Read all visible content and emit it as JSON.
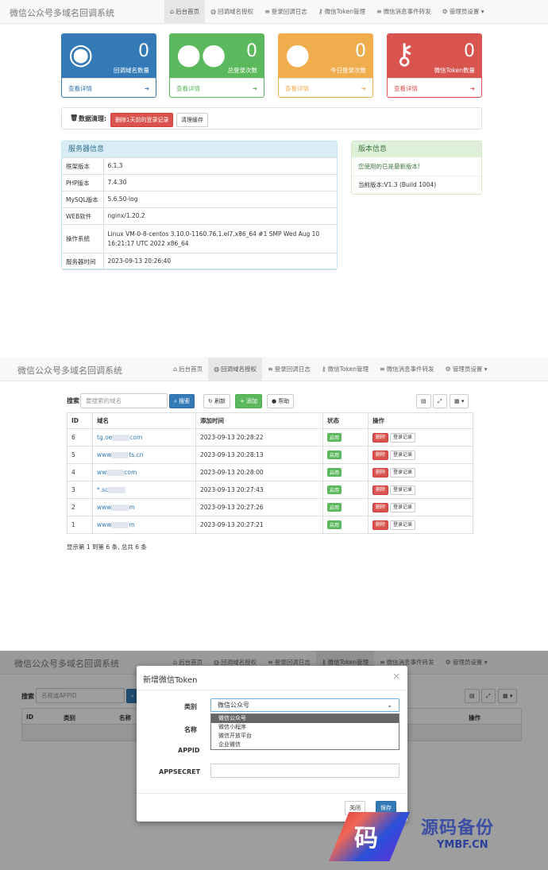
{
  "app_title": "微信公众号多域名回调系统",
  "nav": [
    {
      "label": "后台首页",
      "icon": "home-icon",
      "glyph": "⌂"
    },
    {
      "label": "回调域名授权",
      "icon": "globe-icon",
      "glyph": "◍"
    },
    {
      "label": "登录回调日志",
      "icon": "list-icon",
      "glyph": "≡"
    },
    {
      "label": "微信Token管理",
      "icon": "key-icon",
      "glyph": "⚷"
    },
    {
      "label": "微信消息事件转发",
      "icon": "list-icon",
      "glyph": "≡"
    },
    {
      "label": "管理员设置",
      "icon": "gear-icon",
      "glyph": "⚙",
      "suffix": " ▾"
    }
  ],
  "stats": [
    {
      "value": "0",
      "label": "回调域名数量",
      "link": "查看详情",
      "icon": "globe-icon",
      "glyph": "◉",
      "color": "#337ab7",
      "light": "#fff"
    },
    {
      "value": "0",
      "label": "总登录次数",
      "link": "查看详情",
      "icon": "users-icon",
      "glyph": "●●",
      "color": "#5cb85c",
      "light": "#fff"
    },
    {
      "value": "0",
      "label": "今日登录次数",
      "link": "查看详情",
      "icon": "user-icon",
      "glyph": "●",
      "color": "#f0ad4e",
      "light": "#fff"
    },
    {
      "value": "0",
      "label": "微信Token数量",
      "link": "查看详情",
      "icon": "key-icon",
      "glyph": "⚷",
      "color": "#d9534f",
      "light": "#fff"
    }
  ],
  "cleanup": {
    "label": "数据清理:",
    "delete_btn": "删除1天前的登录记录",
    "clear_btn": "清理缓存"
  },
  "server": {
    "title": "服务器信息",
    "rows": [
      [
        "框架版本",
        "6.1.3"
      ],
      [
        "PHP版本",
        "7.4.30"
      ],
      [
        "MySQL版本",
        "5.6.50-log"
      ],
      [
        "WEB软件",
        "nginx/1.20.2"
      ],
      [
        "操作系统",
        "Linux VM-0-8-centos 3.10.0-1160.76.1.el7.x86_64 #1 SMP Wed Aug 10 16:21:17 UTC 2022 x86_64"
      ],
      [
        "服务器时间",
        "2023-09-13 20:26:40"
      ]
    ]
  },
  "version": {
    "title": "版本信息",
    "status": "您使用的已是最新版本!",
    "current": "当前版本:V1.3 (Build 1004)"
  },
  "domains": {
    "search_label": "搜索",
    "search_placeholder": "要搜索的域名",
    "search_btn": "搜索",
    "refresh_btn": "刷新",
    "add_btn": "添加",
    "help_btn": "帮助",
    "headers": [
      "ID",
      "域名",
      "添加时间",
      "状态",
      "操作"
    ],
    "rows": [
      {
        "id": "6",
        "a": "tg.oe",
        "b": "com",
        "time": "2023-09-13 20:28:22"
      },
      {
        "id": "5",
        "a": "www",
        "b": "ts.cn",
        "time": "2023-09-13 20:28:13"
      },
      {
        "id": "4",
        "a": "ww",
        "b": "com",
        "time": "2023-09-13 20:28:00"
      },
      {
        "id": "3",
        "a": "*.sc",
        "b": "",
        "time": "2023-09-13 20:27:43"
      },
      {
        "id": "2",
        "a": "www",
        "b": "m",
        "time": "2023-09-13 20:27:26"
      },
      {
        "id": "1",
        "a": "www",
        "b": "m",
        "time": "2023-09-13 20:27:21"
      }
    ],
    "status": "启用",
    "del": "删除",
    "log": "登录记录",
    "footer": "显示第 1 到第 6 条, 总共 6 条"
  },
  "token": {
    "search_label": "搜索",
    "search_placeholder": "名称或APPID",
    "headers": [
      "ID",
      "类别",
      "名称",
      "操作"
    ],
    "modal_title": "新增微信Token",
    "close": "×",
    "type_label": "类别",
    "type_value": "微信公众号",
    "options": [
      "微信公众号",
      "微信小程序",
      "微信开放平台",
      "企业微信"
    ],
    "name_label": "名称",
    "appid_label": "APPID",
    "secret_label": "APPSECRET",
    "cancel": "关闭",
    "save": "保存"
  },
  "watermark": {
    "main": "源码备份",
    "sub": "YMBF.CN",
    "badge": "码"
  }
}
